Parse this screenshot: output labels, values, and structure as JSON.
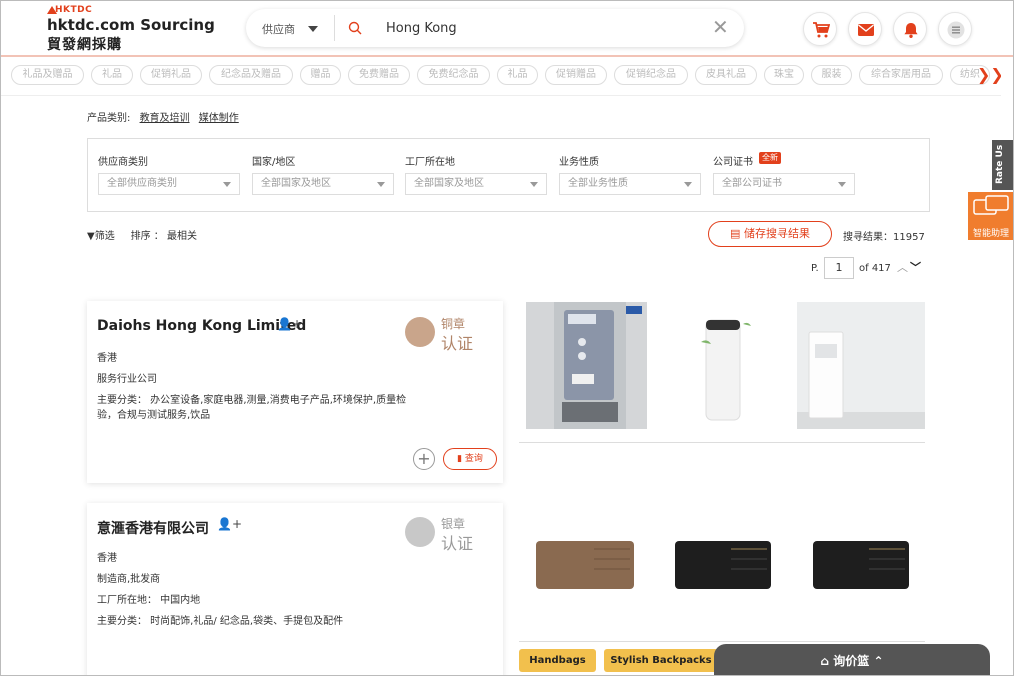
{
  "header": {
    "logo_small": "HKTDC",
    "logo_main": "hktdc.com Sourcing",
    "logo_cn": "貿發網採購",
    "search_type": "供应商",
    "search_value": "Hong Kong"
  },
  "categories": [
    "礼品及赠品",
    "礼品",
    "促销礼品",
    "纪念品及赠品",
    "赠品",
    "免费赠品",
    "免费纪念品",
    "礼品",
    "促销赠品",
    "促销纪念品",
    "皮具礼品",
    "珠宝",
    "服装",
    "综合家居用品",
    "纺织"
  ],
  "breadcrumb": {
    "label": "产品类别:",
    "links": [
      "教育及培训",
      "媒体制作"
    ]
  },
  "filters": [
    {
      "label": "供应商类别",
      "placeholder": "全部供应商类别"
    },
    {
      "label": "国家/地区",
      "placeholder": "全部国家及地区"
    },
    {
      "label": "工厂所在地",
      "placeholder": "全部国家及地区"
    },
    {
      "label": "业务性质",
      "placeholder": "全部业务性质"
    },
    {
      "label": "公司证书",
      "placeholder": "全部公司证书",
      "badge": "全新"
    }
  ],
  "sortbar": {
    "filter_label": "筛选",
    "sort_label": "排序 ：",
    "sort_value": "最相关"
  },
  "save_search": "储存搜寻结果",
  "results": "搜寻结果：11957",
  "pager": {
    "prefix": "P.",
    "page": "1",
    "of": "of 417"
  },
  "suppliers": [
    {
      "name": "Daiohs Hong Kong Limited",
      "cert_line1": "铜章",
      "cert_line2": "认证",
      "region": "香港",
      "business": "服务行业公司",
      "main": "主要分类： 办公室设备,家庭电器,测量,消费电子产品,环境保护,质量检验，合规与测试服务,饮品",
      "inquiry": "查询"
    },
    {
      "name": "意滙香港有限公司",
      "cert_line1": "银章",
      "cert_line2": "认证",
      "region": "香港",
      "business": "制造商,批发商",
      "factory": "工厂所在地： 中国内地",
      "main": "主要分类： 时尚配饰,礼品/ 纪念品,袋类、手提包及配件"
    }
  ],
  "tags": [
    "Handbags",
    "Stylish Backpacks"
  ],
  "basket": "询价篮",
  "side": {
    "rate_us": "Rate Us",
    "assistant": "智能助理"
  },
  "colors": {
    "accent": "#e2401c",
    "tag": "#f2c04d",
    "basket": "#555555"
  }
}
